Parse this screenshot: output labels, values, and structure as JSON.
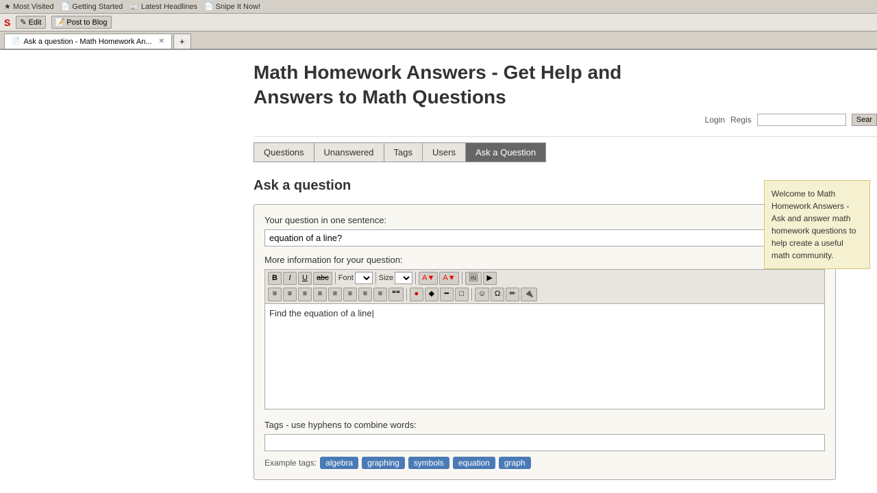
{
  "browser": {
    "bookmarks": [
      {
        "label": "Most Visited",
        "icon": "★"
      },
      {
        "label": "Getting Started",
        "icon": "📄"
      },
      {
        "label": "Latest Headlines",
        "icon": "📰"
      },
      {
        "label": "Snipe It Now!",
        "icon": "📄"
      }
    ],
    "toolbar_items": [
      {
        "label": "Edit"
      },
      {
        "label": "Post to Blog"
      }
    ],
    "tab_title": "Ask a question - Math Homework An..."
  },
  "site": {
    "title_line1": "Math Homework Answers - Get Help and",
    "title_line2": "Answers to Math Questions",
    "login": "Login",
    "register": "Regis",
    "search_placeholder": "",
    "search_btn": "Sear"
  },
  "nav": {
    "items": [
      {
        "label": "Questions",
        "active": false
      },
      {
        "label": "Unanswered",
        "active": false
      },
      {
        "label": "Tags",
        "active": false
      },
      {
        "label": "Users",
        "active": false
      },
      {
        "label": "Ask a Question",
        "active": true
      }
    ]
  },
  "page": {
    "title": "Ask a question",
    "question_label": "Your question in one sentence:",
    "question_value": "equation of a line?",
    "more_info_label": "More information for your question:",
    "editor_content": "Find the equation of a line",
    "tags_label": "Tags - use hyphens to combine words:",
    "tags_value": "",
    "example_tags_label": "Example tags:",
    "example_tags": [
      "algebra",
      "graphing",
      "symbols",
      "equation",
      "graph"
    ]
  },
  "toolbar": {
    "bold": "B",
    "italic": "I",
    "underline": "U",
    "strike": "abc",
    "font_label": "Font",
    "size_label": "Size",
    "row2_icons": [
      "≡",
      "≡",
      "≡",
      "≡",
      "≡",
      "≡",
      "≡",
      "≡",
      "❝❝",
      "●",
      "◆",
      "━",
      "□",
      "☺",
      "Ω",
      "✏",
      "🔌"
    ]
  },
  "welcome": {
    "text": "Welcome to Math Homework Answers - Ask and answer math homework questions to help create a useful math community."
  }
}
